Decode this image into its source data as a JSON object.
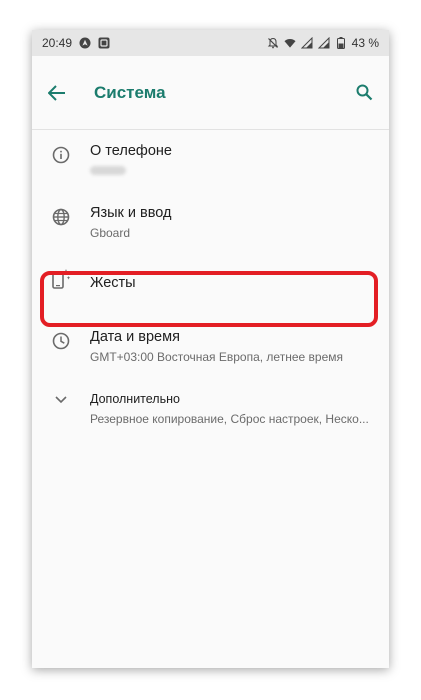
{
  "status_bar": {
    "time": "20:49",
    "battery_percent": "43 %",
    "left_icons": [
      "android-auto-icon",
      "screenshot-icon"
    ],
    "right_icons": [
      "mute-icon",
      "wifi-icon",
      "signal-icon",
      "signal-icon",
      "battery-icon"
    ]
  },
  "app_bar": {
    "title": "Система",
    "back_icon": "arrow-back-icon",
    "search_icon": "search-icon",
    "accent_color": "#1b7c6d"
  },
  "settings": [
    {
      "title": "О телефоне",
      "subtitle": "",
      "icon": "info-icon",
      "subtitle_redacted": true
    },
    {
      "title": "Язык и ввод",
      "subtitle": "Gboard",
      "icon": "globe-icon"
    },
    {
      "title": "Жесты",
      "subtitle": "",
      "icon": "gestures-icon"
    },
    {
      "title": "Дата и время",
      "subtitle": "GMT+03:00 Восточная Европа, летнее время",
      "icon": "clock-icon",
      "highlighted": true
    },
    {
      "title": "Дополнительно",
      "subtitle": "Резервное копирование, Сброс настроек, Неско...",
      "icon": "chevron-down-icon"
    }
  ],
  "highlight_color": "#e31e24"
}
